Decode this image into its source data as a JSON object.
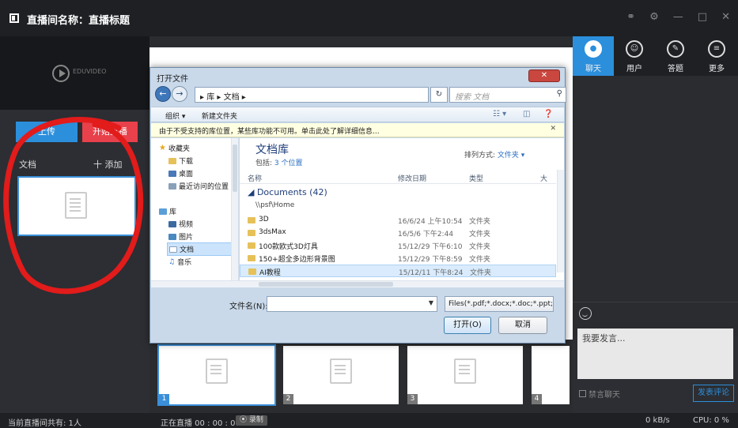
{
  "window": {
    "title": "直播间名称：直播标题",
    "controls": [
      "share-icon",
      "settings-icon",
      "minimize-icon",
      "maximize-icon",
      "close-icon"
    ]
  },
  "left_panel": {
    "logo_text": "EDUVIDEO",
    "upload_label": "上传",
    "start_live_label": "开始直播",
    "doc_label": "文档",
    "add_label": "十 添加"
  },
  "right_panel": {
    "tabs": [
      {
        "label": "聊天",
        "icon": "chat-icon",
        "active": true
      },
      {
        "label": "用户",
        "icon": "users-icon",
        "active": false
      },
      {
        "label": "答题",
        "icon": "pencil-icon",
        "active": false
      },
      {
        "label": "更多",
        "icon": "more-icon",
        "active": false
      }
    ],
    "chat_placeholder": "我要发言...",
    "mute_label": "禁言聊天",
    "send_label": "发表评论"
  },
  "thumbnails": [
    "1",
    "2",
    "3",
    "4"
  ],
  "status": {
    "viewers": "当前直播间共有: 1人",
    "live_time": "正在直播 00 : 00 : 00",
    "record": "⦿ 录制",
    "net": "0 kB/s",
    "cpu": "CPU: 0 %"
  },
  "dialog": {
    "title": "打开文件",
    "address": "▸ 库 ▸ 文档 ▸",
    "search_placeholder": "搜索 文档",
    "toolbar": {
      "organize": "组织 ▾",
      "new_folder": "新建文件夹"
    },
    "info": "由于不受支持的库位置，某些库功能不可用。单击此处了解详细信息...",
    "nav": {
      "favorites": "收藏夹",
      "downloads": "下载",
      "desktop": "桌面",
      "recent": "最近访问的位置",
      "libraries": "库",
      "videos": "视频",
      "pictures": "图片",
      "documents": "文档",
      "music": "音乐"
    },
    "library_title": "文档库",
    "library_sub_prefix": "包括: ",
    "library_sub_link": "3 个位置",
    "sort_label": "排列方式: ",
    "sort_value": "文件夹 ▾",
    "columns": {
      "name": "名称",
      "date": "修改日期",
      "type": "类型",
      "size": "大"
    },
    "group": "◢ Documents (42)",
    "group_path": "\\\\psf\\Home",
    "files": [
      {
        "name": "3D",
        "date": "16/6/24 上午10:54",
        "type": "文件夹"
      },
      {
        "name": "3dsMax",
        "date": "16/5/6 下午2:44",
        "type": "文件夹"
      },
      {
        "name": "100款欧式3D灯具",
        "date": "15/12/29 下午6:10",
        "type": "文件夹"
      },
      {
        "name": "150+超全多边形背景图",
        "date": "15/12/29 下午8:59",
        "type": "文件夹"
      },
      {
        "name": "AI教程",
        "date": "15/12/11 下午8:24",
        "type": "文件夹"
      }
    ],
    "filename_label": "文件名(N):",
    "filetype": "Files(*.pdf;*.docx;*.doc;*.ppt;",
    "open_label": "打开(O)",
    "cancel_label": "取消"
  },
  "colors": {
    "accent": "#2b8fdc",
    "live": "#e8414b",
    "annotation": "#e21b1b"
  }
}
